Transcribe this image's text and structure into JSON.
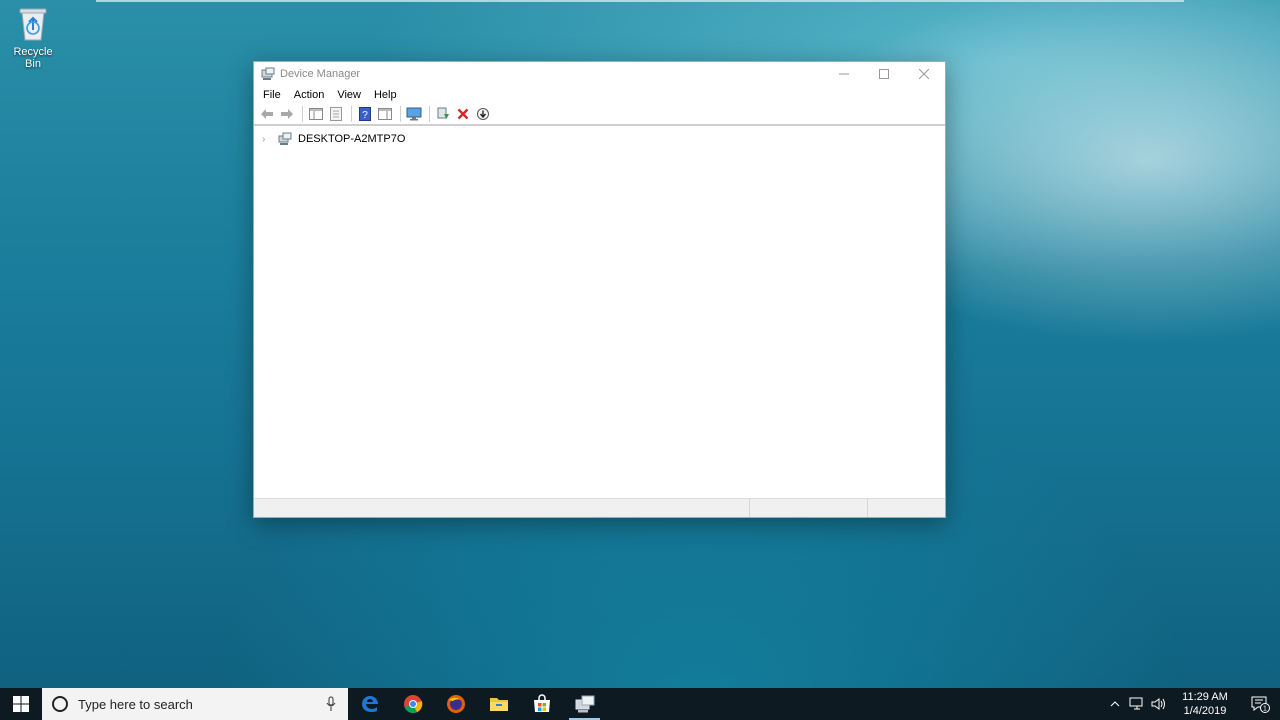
{
  "desktop": {
    "recycle_bin_label": "Recycle Bin"
  },
  "window": {
    "title": "Device Manager",
    "menu": [
      "File",
      "Action",
      "View",
      "Help"
    ],
    "toolbar_icons": [
      "back-icon",
      "forward-icon",
      "show-hide-console-tree-icon",
      "properties-icon",
      "help-icon",
      "action-pane-icon",
      "monitor-icon",
      "update-driver-icon",
      "uninstall-icon",
      "scan-hardware-icon"
    ],
    "tree": {
      "root": "DESKTOP-A2MTP7O",
      "expanded": false
    }
  },
  "taskbar": {
    "search_placeholder": "Type here to search",
    "pinned_apps": [
      "edge-icon",
      "chrome-icon",
      "firefox-icon",
      "file-explorer-icon",
      "store-icon",
      "device-manager-icon"
    ],
    "active_app": "device-manager-icon",
    "time": "11:29 AM",
    "date": "1/4/2019",
    "notification_count": "1"
  },
  "colors": {
    "taskbar_bg": "#0e1a22",
    "window_border": "#8ab2c4",
    "active_indicator": "#9ccbe6"
  }
}
